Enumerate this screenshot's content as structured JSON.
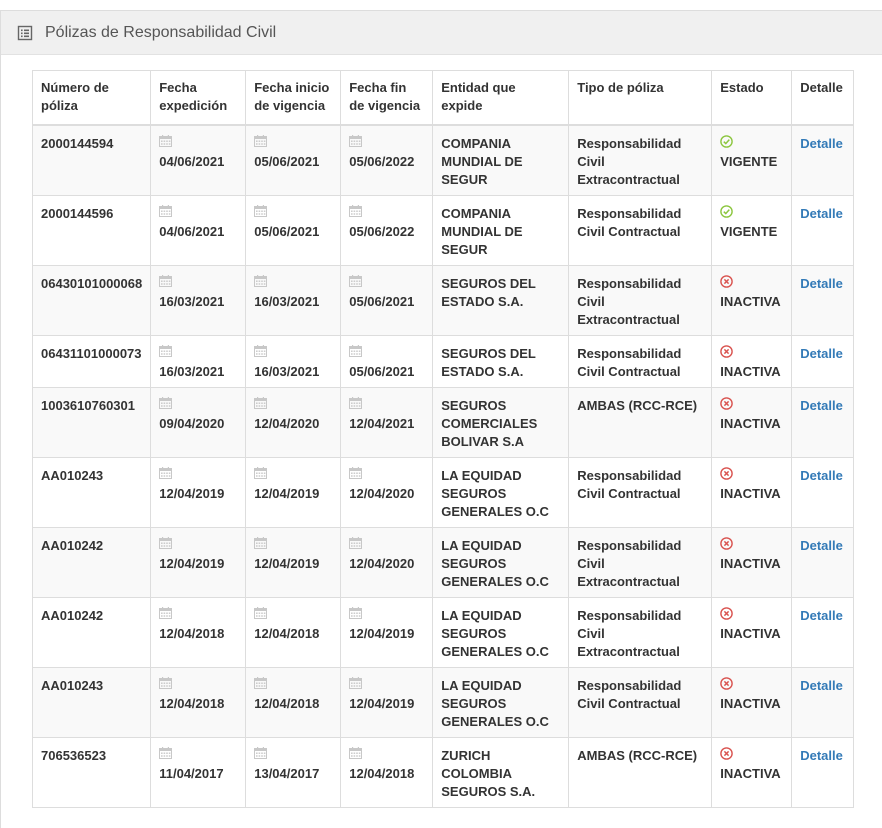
{
  "panel": {
    "title": "Pólizas de Responsabilidad Civil",
    "icon": "list-icon"
  },
  "table": {
    "headers": {
      "numero": "Número de póliza",
      "expedicion": "Fecha expedición",
      "inicio": "Fecha inicio de vigencia",
      "fin": "Fecha fin de vigencia",
      "entidad": "Entidad que expide",
      "tipo": "Tipo de póliza",
      "estado": "Estado",
      "detalle": "Detalle"
    },
    "rows": [
      {
        "numero": "2000144594",
        "expedicion": "04/06/2021",
        "inicio": "05/06/2021",
        "fin": "05/06/2022",
        "entidad": "COMPANIA MUNDIAL DE SEGUR",
        "tipo": "Responsabilidad Civil Extracontractual",
        "estado": "VIGENTE",
        "status": "active",
        "detalle": "Detalle"
      },
      {
        "numero": "2000144596",
        "expedicion": "04/06/2021",
        "inicio": "05/06/2021",
        "fin": "05/06/2022",
        "entidad": "COMPANIA MUNDIAL DE SEGUR",
        "tipo": "Responsabilidad Civil Contractual",
        "estado": "VIGENTE",
        "status": "active",
        "detalle": "Detalle"
      },
      {
        "numero": "06430101000068",
        "expedicion": "16/03/2021",
        "inicio": "16/03/2021",
        "fin": "05/06/2021",
        "entidad": "SEGUROS DEL ESTADO S.A.",
        "tipo": "Responsabilidad Civil Extracontractual",
        "estado": "INACTIVA",
        "status": "inactive",
        "detalle": "Detalle"
      },
      {
        "numero": "06431101000073",
        "expedicion": "16/03/2021",
        "inicio": "16/03/2021",
        "fin": "05/06/2021",
        "entidad": "SEGUROS DEL ESTADO S.A.",
        "tipo": "Responsabilidad Civil Contractual",
        "estado": "INACTIVA",
        "status": "inactive",
        "detalle": "Detalle"
      },
      {
        "numero": "1003610760301",
        "expedicion": "09/04/2020",
        "inicio": "12/04/2020",
        "fin": "12/04/2021",
        "entidad": "SEGUROS COMERCIALES BOLIVAR S.A",
        "tipo": "AMBAS (RCC-RCE)",
        "estado": "INACTIVA",
        "status": "inactive",
        "detalle": "Detalle"
      },
      {
        "numero": "AA010243",
        "expedicion": "12/04/2019",
        "inicio": "12/04/2019",
        "fin": "12/04/2020",
        "entidad": "LA EQUIDAD SEGUROS GENERALES O.C",
        "tipo": "Responsabilidad Civil Contractual",
        "estado": "INACTIVA",
        "status": "inactive",
        "detalle": "Detalle"
      },
      {
        "numero": "AA010242",
        "expedicion": "12/04/2019",
        "inicio": "12/04/2019",
        "fin": "12/04/2020",
        "entidad": "LA EQUIDAD SEGUROS GENERALES O.C",
        "tipo": "Responsabilidad Civil Extracontractual",
        "estado": "INACTIVA",
        "status": "inactive",
        "detalle": "Detalle"
      },
      {
        "numero": "AA010242",
        "expedicion": "12/04/2018",
        "inicio": "12/04/2018",
        "fin": "12/04/2019",
        "entidad": "LA EQUIDAD SEGUROS GENERALES O.C",
        "tipo": "Responsabilidad Civil Extracontractual",
        "estado": "INACTIVA",
        "status": "inactive",
        "detalle": "Detalle"
      },
      {
        "numero": "AA010243",
        "expedicion": "12/04/2018",
        "inicio": "12/04/2018",
        "fin": "12/04/2019",
        "entidad": "LA EQUIDAD SEGUROS GENERALES O.C",
        "tipo": "Responsabilidad Civil Contractual",
        "estado": "INACTIVA",
        "status": "inactive",
        "detalle": "Detalle"
      },
      {
        "numero": "706536523",
        "expedicion": "11/04/2017",
        "inicio": "13/04/2017",
        "fin": "12/04/2018",
        "entidad": "ZURICH COLOMBIA SEGUROS S.A.",
        "tipo": "AMBAS (RCC-RCE)",
        "estado": "INACTIVA",
        "status": "inactive",
        "detalle": "Detalle"
      }
    ]
  },
  "colors": {
    "active": "#8cc63f",
    "inactive": "#d9534f",
    "link": "#337ab7",
    "calendar_icon": "#c8c8c8"
  },
  "icons": {
    "date": "calendar-icon",
    "active": "check-circle-icon",
    "inactive": "times-circle-icon"
  }
}
